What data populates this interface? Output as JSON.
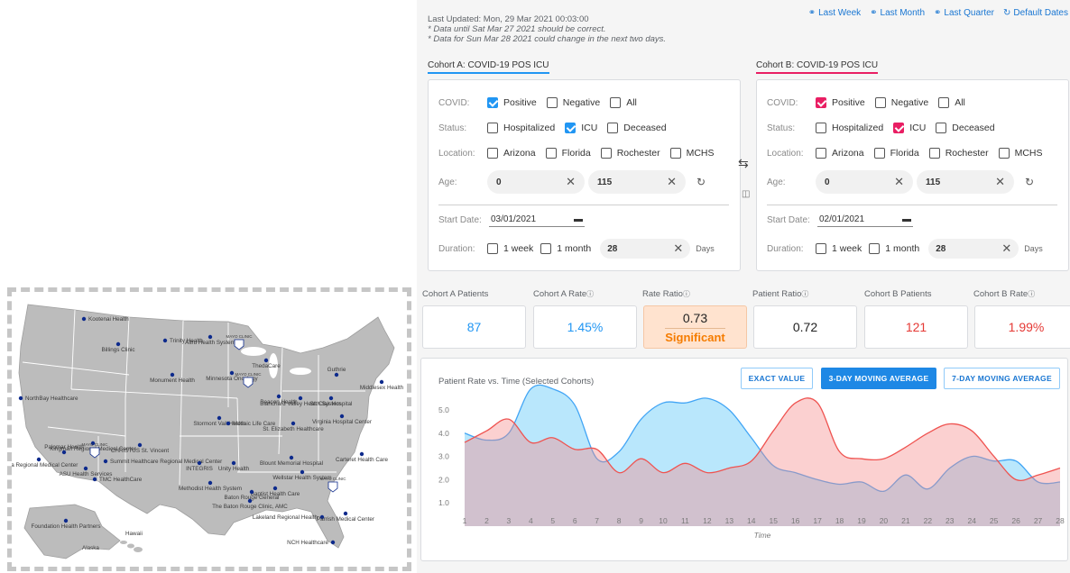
{
  "map": {
    "sites": [
      {
        "name": "Kootenai Health"
      },
      {
        "name": "Billings Clinic"
      },
      {
        "name": "Trinity Health"
      },
      {
        "name": "Altru Health System"
      },
      {
        "name": "ThedaCare"
      },
      {
        "name": "Monument Health"
      },
      {
        "name": "Minnesota Oncology"
      },
      {
        "name": "Guthrie"
      },
      {
        "name": "Middlesex Health"
      },
      {
        "name": "NorthBay Healthcare"
      },
      {
        "name": "Beacon Health"
      },
      {
        "name": "Blanchard Valley Health System"
      },
      {
        "name": "St. Clair Hospital"
      },
      {
        "name": "Stormont Vail Health"
      },
      {
        "name": "Mosaic Life Care"
      },
      {
        "name": "St. Elizabeth Healthcare"
      },
      {
        "name": "Virginia Hospital Center"
      },
      {
        "name": "Kingman Regional Medical Center"
      },
      {
        "name": "CHRISTUS St. Vincent"
      },
      {
        "name": "Palomar Health"
      },
      {
        "name": "Summit Healthcare Regional Medical Center"
      },
      {
        "name": "INTEGRIS"
      },
      {
        "name": "Unity Health"
      },
      {
        "name": "Blount Memorial Hospital"
      },
      {
        "name": "Carteret Health Care"
      },
      {
        "name": "Yuma Regional Medical Center"
      },
      {
        "name": "ASU Health Services"
      },
      {
        "name": "TMC HealthCare"
      },
      {
        "name": "Wellstar Health System"
      },
      {
        "name": "Methodist Health System"
      },
      {
        "name": "Baptist Health Care"
      },
      {
        "name": "Baton Rouge General"
      },
      {
        "name": "The Baton Rouge Clinic, AMC"
      },
      {
        "name": "Lakeland Regional Health"
      },
      {
        "name": "Parrish Medical Center"
      },
      {
        "name": "Foundation Health Partners"
      },
      {
        "name": "NCH Healthcare"
      }
    ],
    "mayo_label": "MAYO CLINIC",
    "alaska_label": "Alaska",
    "hawaii_label": "Hawaii"
  },
  "header": {
    "last_updated": "Last Updated: Mon, 29 Mar 2021 00:03:00",
    "note1": "* Data until Sat Mar 27 2021 should be correct.",
    "note2": "* Data for Sun Mar 28 2021 could change in the next two days.",
    "links": [
      "Last Week",
      "Last Month",
      "Last Quarter",
      "Default Dates"
    ]
  },
  "cohortA": {
    "title": "Cohort A: COVID-19 POS ICU",
    "color": "#2196f3",
    "covid_label": "COVID:",
    "covid_options": [
      {
        "label": "Positive",
        "checked": true
      },
      {
        "label": "Negative",
        "checked": false
      },
      {
        "label": "All",
        "checked": false
      }
    ],
    "status_label": "Status:",
    "status_options": [
      {
        "label": "Hospitalized",
        "checked": false
      },
      {
        "label": "ICU",
        "checked": true
      },
      {
        "label": "Deceased",
        "checked": false
      }
    ],
    "location_label": "Location:",
    "location_options": [
      {
        "label": "Arizona",
        "checked": false
      },
      {
        "label": "Florida",
        "checked": false
      },
      {
        "label": "Rochester",
        "checked": false
      },
      {
        "label": "MCHS",
        "checked": false
      }
    ],
    "age_label": "Age:",
    "age_min": "0",
    "age_max": "115",
    "start_date_label": "Start Date:",
    "start_date": "03/01/2021",
    "duration_label": "Duration:",
    "duration_options": [
      {
        "label": "1 week",
        "checked": false
      },
      {
        "label": "1 month",
        "checked": false
      }
    ],
    "duration_value": "28",
    "days_label": "Days"
  },
  "cohortB": {
    "title": "Cohort B: COVID-19 POS ICU",
    "color": "#e91e63",
    "covid_label": "COVID:",
    "covid_options": [
      {
        "label": "Positive",
        "checked": true
      },
      {
        "label": "Negative",
        "checked": false
      },
      {
        "label": "All",
        "checked": false
      }
    ],
    "status_label": "Status:",
    "status_options": [
      {
        "label": "Hospitalized",
        "checked": false
      },
      {
        "label": "ICU",
        "checked": true
      },
      {
        "label": "Deceased",
        "checked": false
      }
    ],
    "location_label": "Location:",
    "location_options": [
      {
        "label": "Arizona",
        "checked": false
      },
      {
        "label": "Florida",
        "checked": false
      },
      {
        "label": "Rochester",
        "checked": false
      },
      {
        "label": "MCHS",
        "checked": false
      }
    ],
    "age_label": "Age:",
    "age_min": "0",
    "age_max": "115",
    "start_date_label": "Start Date:",
    "start_date": "02/01/2021",
    "duration_label": "Duration:",
    "duration_options": [
      {
        "label": "1 week",
        "checked": false
      },
      {
        "label": "1 month",
        "checked": false
      }
    ],
    "duration_value": "28",
    "days_label": "Days"
  },
  "metrics": {
    "labels": [
      "Cohort A Patients",
      "Cohort A Rate",
      "Rate Ratio",
      "Patient Ratio",
      "Cohort B Patients",
      "Cohort B Rate"
    ],
    "cohortA_patients": "87",
    "cohortA_rate": "1.45%",
    "rate_ratio": "0.73",
    "rate_ratio_status": "Significant",
    "patient_ratio": "0.72",
    "cohortB_patients": "121",
    "cohortB_rate": "1.99%"
  },
  "chart": {
    "title": "Patient Rate vs. Time (Selected Cohorts)",
    "buttons": [
      "EXACT VALUE",
      "3-DAY MOVING AVERAGE",
      "7-DAY MOVING AVERAGE"
    ],
    "active_button": "3-DAY MOVING AVERAGE"
  },
  "chart_data": {
    "type": "area",
    "title": "Patient Rate vs. Time (Selected Cohorts)",
    "xlabel": "Time",
    "ylabel": "",
    "x": [
      1,
      2,
      3,
      4,
      5,
      6,
      7,
      8,
      9,
      10,
      11,
      12,
      13,
      14,
      15,
      16,
      17,
      18,
      19,
      20,
      21,
      22,
      23,
      24,
      25,
      26,
      27,
      28
    ],
    "yticks": [
      1.0,
      2.0,
      3.0,
      4.0,
      5.0
    ],
    "ylim": [
      0,
      6.2
    ],
    "series": [
      {
        "name": "Cohort A",
        "color": "#4fc3f7",
        "values": [
          4.0,
          3.7,
          4.0,
          5.9,
          5.9,
          5.2,
          2.9,
          3.2,
          4.6,
          5.3,
          5.3,
          5.5,
          5.0,
          3.8,
          2.6,
          2.3,
          2.0,
          1.8,
          1.9,
          1.5,
          2.2,
          1.6,
          2.5,
          3.0,
          2.8,
          2.8,
          1.9,
          1.9
        ]
      },
      {
        "name": "Cohort B",
        "color": "#f48a8a",
        "values": [
          3.6,
          4.1,
          4.6,
          3.6,
          3.8,
          3.3,
          3.3,
          2.3,
          2.9,
          2.3,
          2.7,
          2.3,
          2.5,
          2.8,
          4.1,
          5.3,
          5.3,
          3.2,
          2.9,
          2.9,
          3.4,
          4.0,
          4.4,
          4.1,
          3.0,
          2.0,
          2.2,
          2.5
        ]
      }
    ],
    "legend": "none",
    "grid": false
  }
}
